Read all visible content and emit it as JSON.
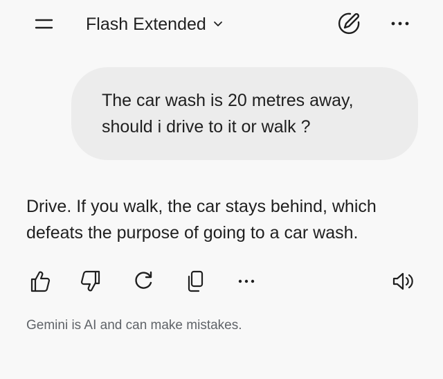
{
  "header": {
    "model_name": "Flash",
    "model_variant": "Extended",
    "icons": [
      "menu-icon",
      "chevron-down-icon",
      "new-chat-icon",
      "more-horizontal-icon"
    ]
  },
  "conversation": {
    "user_message_line1": "The car wash is 20 metres away,",
    "user_message_line2": "should i drive to it or walk ?",
    "response_line1": "Drive. If you walk, the car stays behind, which",
    "response_line2": "defeats the purpose of going to a car wash."
  },
  "actions": {
    "icons": [
      "thumbs-up-icon",
      "thumbs-down-icon",
      "regenerate-icon",
      "copy-icon",
      "more-horizontal-icon",
      "speaker-icon"
    ]
  },
  "footer": {
    "disclaimer": "Gemini is AI and can make mistakes."
  },
  "colors": {
    "background": "#f8f8f8",
    "bubble": "#ececec",
    "text": "#1f1f1f",
    "muted": "#5f6368"
  }
}
